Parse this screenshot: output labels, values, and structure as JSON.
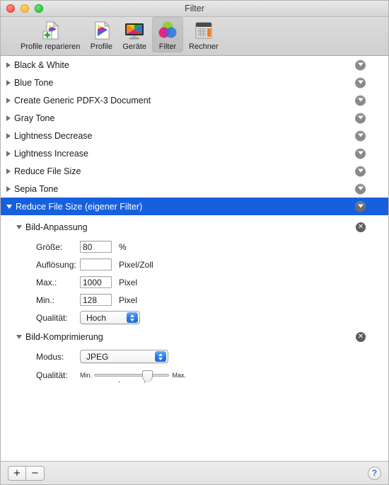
{
  "window": {
    "title": "Filter",
    "traffic_lights": [
      "close-button",
      "minimize-button",
      "zoom-button"
    ]
  },
  "toolbar": {
    "items": [
      {
        "label": "Profile reparieren",
        "icon": "profile-repair-icon",
        "selected": false
      },
      {
        "label": "Profile",
        "icon": "profile-icon",
        "selected": false
      },
      {
        "label": "Geräte",
        "icon": "devices-icon",
        "selected": false
      },
      {
        "label": "Filter",
        "icon": "filter-icon",
        "selected": true
      },
      {
        "label": "Rechner",
        "icon": "calculator-icon",
        "selected": false
      }
    ]
  },
  "filter_list": [
    {
      "label": "Black & White",
      "expanded": false,
      "selected": false
    },
    {
      "label": "Blue Tone",
      "expanded": false,
      "selected": false
    },
    {
      "label": "Create Generic PDFX-3 Document",
      "expanded": false,
      "selected": false
    },
    {
      "label": "Gray Tone",
      "expanded": false,
      "selected": false
    },
    {
      "label": "Lightness Decrease",
      "expanded": false,
      "selected": false
    },
    {
      "label": "Lightness Increase",
      "expanded": false,
      "selected": false
    },
    {
      "label": "Reduce File Size",
      "expanded": false,
      "selected": false
    },
    {
      "label": "Sepia Tone",
      "expanded": false,
      "selected": false
    },
    {
      "label": "Reduce File Size (eigener Filter)",
      "expanded": true,
      "selected": true
    }
  ],
  "detail": {
    "image_adjust": {
      "title": "Bild-Anpassung",
      "close_glyph": "✕",
      "fields": [
        {
          "label": "Größe:",
          "value": "80",
          "unit": "%"
        },
        {
          "label": "Auflösung:",
          "value": "",
          "unit": "Pixel/Zoll"
        },
        {
          "label": "Max.:",
          "value": "1000",
          "unit": "Pixel"
        },
        {
          "label": "Min.:",
          "value": "128",
          "unit": "Pixel"
        }
      ],
      "quality": {
        "label": "Qualität:",
        "value": "Hoch"
      }
    },
    "image_compression": {
      "title": "Bild-Komprimierung",
      "close_glyph": "✕",
      "mode": {
        "label": "Modus:",
        "value": "JPEG"
      },
      "quality_slider": {
        "label": "Qualität:",
        "min_label": "Min.",
        "max_label": "Max.",
        "value_percent": 70
      }
    }
  },
  "bottom_bar": {
    "add_label": "+",
    "remove_label": "−",
    "help_label": "?"
  },
  "colors": {
    "selection_blue": "#1660e0",
    "stepper_blue": "#2a7bea",
    "help_blue": "#2f76d8"
  }
}
